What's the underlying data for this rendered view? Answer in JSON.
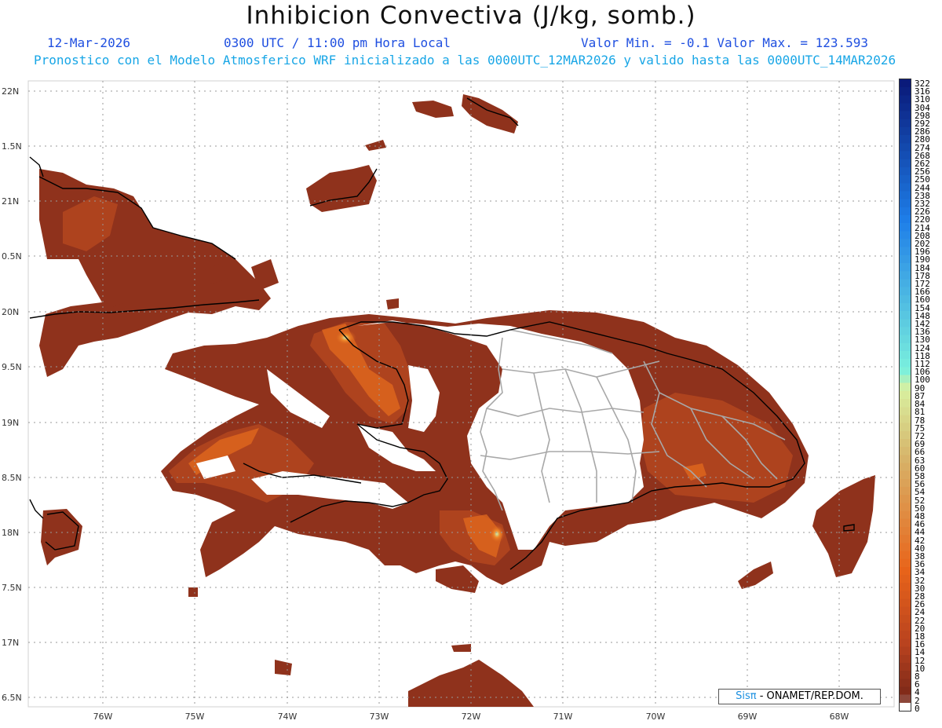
{
  "header": {
    "title": "Inhibicion Convectiva (J/kg, somb.)",
    "date": "12-Mar-2026",
    "time": "0300 UTC / 11:00 pm Hora Local",
    "minmax": "Valor Min. = -0.1  Valor Max. = 123.593",
    "subtitle": "Pronostico con el Modelo Atmosferico WRF inicializado a las 0000UTC_12MAR2026 y valido hasta las  0000UTC_14MAR2026"
  },
  "axes": {
    "lat_labels": [
      "22N",
      "1.5N",
      "21N",
      "0.5N",
      "20N",
      "9.5N",
      "19N",
      "8.5N",
      "18N",
      "7.5N",
      "17N",
      "6.5N"
    ],
    "lon_labels": [
      "76W",
      "75W",
      "74W",
      "73W",
      "72W",
      "71W",
      "70W",
      "69W",
      "68W"
    ]
  },
  "colorbar": {
    "labels": [
      "322",
      "316",
      "310",
      "304",
      "298",
      "292",
      "286",
      "280",
      "274",
      "268",
      "262",
      "256",
      "250",
      "244",
      "238",
      "232",
      "226",
      "220",
      "214",
      "208",
      "202",
      "196",
      "190",
      "184",
      "178",
      "172",
      "166",
      "160",
      "154",
      "148",
      "142",
      "136",
      "130",
      "124",
      "118",
      "112",
      "106",
      "100",
      "90",
      "87",
      "84",
      "81",
      "78",
      "75",
      "72",
      "69",
      "66",
      "63",
      "60",
      "58",
      "56",
      "54",
      "52",
      "50",
      "48",
      "46",
      "44",
      "42",
      "40",
      "38",
      "36",
      "34",
      "32",
      "30",
      "28",
      "26",
      "24",
      "22",
      "20",
      "18",
      "16",
      "14",
      "12",
      "10",
      "8",
      "6",
      "4",
      "2",
      "0"
    ],
    "colors": {
      "top": "#0a1a7a",
      "blue": "#1e7ee8",
      "cyan": "#7af0dd",
      "green": "#d8f0a0",
      "tan": "#d7b46a",
      "orange": "#e8641a",
      "rust": "#b8421f",
      "dark": "#7a2818",
      "zero": "#ffffff"
    }
  },
  "colors": {
    "field_dark": "#8f321c",
    "field_mid": "#b4461f",
    "field_orange": "#e36a1e",
    "field_hot": "#bfe8a0",
    "coastline": "#000000",
    "borders": "#a8a8a8",
    "gridline": "#9a9a9a"
  },
  "credit": {
    "brand": "Sisπ",
    "org": " - ONAMET/REP.DOM."
  }
}
